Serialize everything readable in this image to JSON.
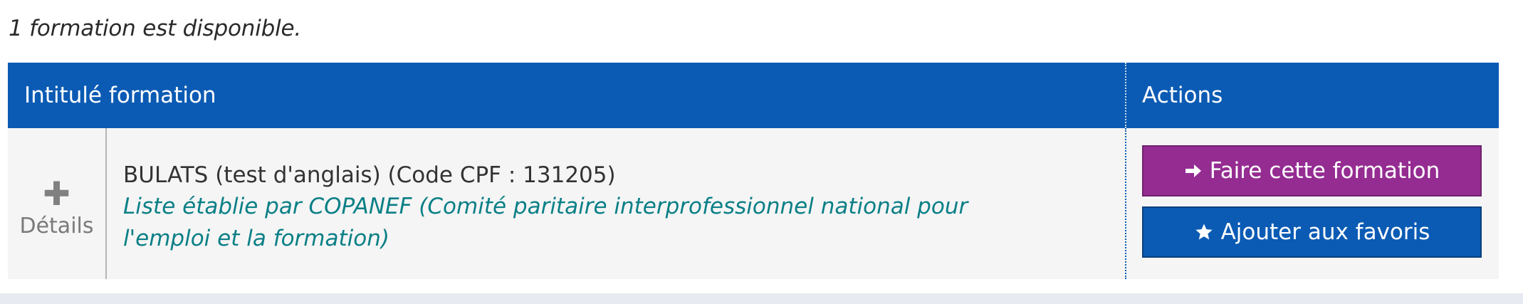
{
  "results": {
    "count_text": "1 formation est disponible."
  },
  "table": {
    "headers": {
      "title": "Intitulé formation",
      "actions": "Actions"
    },
    "rows": [
      {
        "details_icon": "plus-icon",
        "details_label": "Détails",
        "title": "BULATS (test d'anglais) (Code CPF : 131205)",
        "description": "Liste établie par COPANEF (Comité paritaire interprofessionnel national pour l'emploi et la formation)",
        "primary_action": "Faire cette formation",
        "primary_action_icon": "arrow-right-icon",
        "secondary_action": "Ajouter aux favoris",
        "secondary_action_icon": "star-icon"
      }
    ]
  },
  "colors": {
    "header_bg": "#0b5bb4",
    "primary_button": "#952c92",
    "secondary_button": "#0b5bb4",
    "description_text": "#0a7f86"
  }
}
